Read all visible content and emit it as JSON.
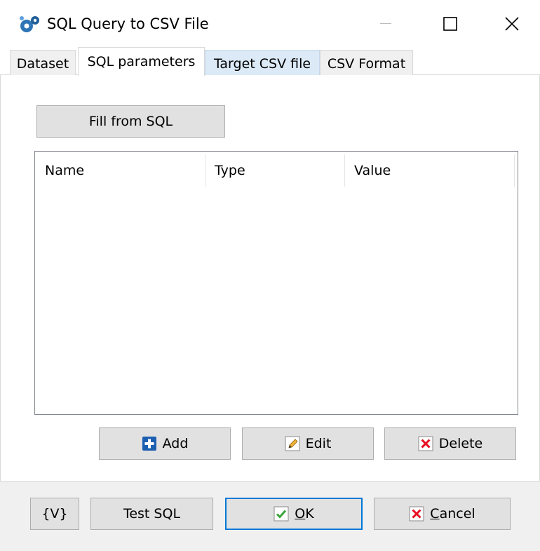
{
  "window": {
    "title": "SQL Query to CSV File",
    "app_icon": "gears-icon",
    "controls": {
      "minimize": "minimize-icon",
      "maximize": "maximize-icon",
      "close": "close-icon"
    }
  },
  "tabs": [
    {
      "label": "Dataset",
      "state": "normal"
    },
    {
      "label": "SQL parameters",
      "state": "selected"
    },
    {
      "label": "Target CSV file",
      "state": "hover"
    },
    {
      "label": "CSV Format",
      "state": "normal"
    }
  ],
  "parameters": {
    "fill_button": "Fill from SQL",
    "columns": [
      "Name",
      "Type",
      "Value"
    ],
    "rows": [],
    "add_button": {
      "label": "Add",
      "icon": "plus-icon"
    },
    "edit_button": {
      "label": "Edit",
      "icon": "pencil-icon"
    },
    "delete_button": {
      "label": "Delete",
      "icon": "delete-x-icon"
    }
  },
  "footer": {
    "vars_button": "{V}",
    "test_button": "Test SQL",
    "ok_button": {
      "mnemonic": "O",
      "rest": "K",
      "icon": "checkmark-icon"
    },
    "cancel_button": {
      "mnemonic": "C",
      "rest": "ancel",
      "icon": "cancel-x-icon"
    }
  },
  "colors": {
    "accent": "#0078d7",
    "button_face": "#e1e1e1",
    "tab_hover": "#dceaf7",
    "add_icon_blue": "#1c5fb1",
    "ok_icon_green": "#3aa53a",
    "cancel_icon_red": "#e81123"
  }
}
